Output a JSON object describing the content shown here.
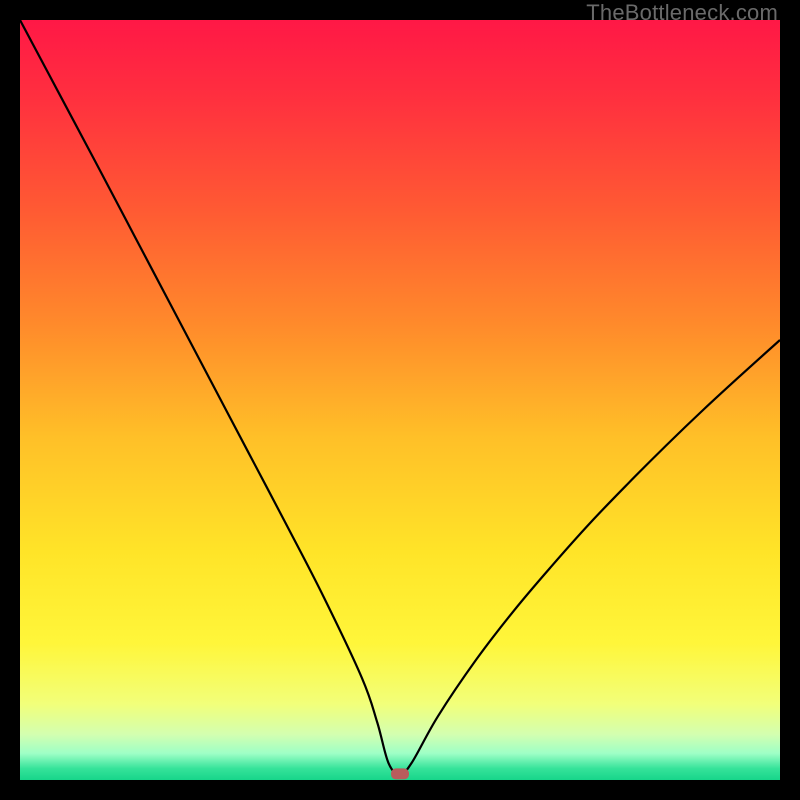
{
  "watermark": "TheBottleneck.com",
  "chart_data": {
    "type": "line",
    "title": "",
    "xlabel": "",
    "ylabel": "",
    "xlim": [
      0,
      100
    ],
    "ylim": [
      0,
      100
    ],
    "grid": false,
    "series": [
      {
        "name": "curve",
        "x": [
          0,
          5,
          10,
          15,
          20,
          25,
          30,
          35,
          40,
          45,
          47,
          48.5,
          50,
          51.5,
          55,
          60,
          65,
          70,
          75,
          80,
          85,
          90,
          95,
          100
        ],
        "y": [
          100,
          90.6,
          81.2,
          71.7,
          62.2,
          52.7,
          43.2,
          33.7,
          24,
          13.4,
          7.6,
          2.2,
          0.8,
          2.2,
          8.4,
          15.8,
          22.3,
          28.2,
          33.8,
          39,
          44,
          48.8,
          53.4,
          57.9
        ]
      }
    ],
    "marker": {
      "x": 50.0,
      "y": 0.8,
      "color": "#b85c5c"
    },
    "background_gradient": {
      "stops": [
        {
          "offset": 0.0,
          "color": "#ff1846"
        },
        {
          "offset": 0.1,
          "color": "#ff2f3f"
        },
        {
          "offset": 0.25,
          "color": "#ff5a33"
        },
        {
          "offset": 0.4,
          "color": "#ff8a2b"
        },
        {
          "offset": 0.55,
          "color": "#ffc028"
        },
        {
          "offset": 0.7,
          "color": "#ffe428"
        },
        {
          "offset": 0.82,
          "color": "#fff63a"
        },
        {
          "offset": 0.9,
          "color": "#f2ff7a"
        },
        {
          "offset": 0.94,
          "color": "#d3ffb0"
        },
        {
          "offset": 0.965,
          "color": "#9effc6"
        },
        {
          "offset": 0.985,
          "color": "#35e39a"
        },
        {
          "offset": 1.0,
          "color": "#17d58a"
        }
      ]
    },
    "line_color": "#000000",
    "line_width": 2.2
  }
}
